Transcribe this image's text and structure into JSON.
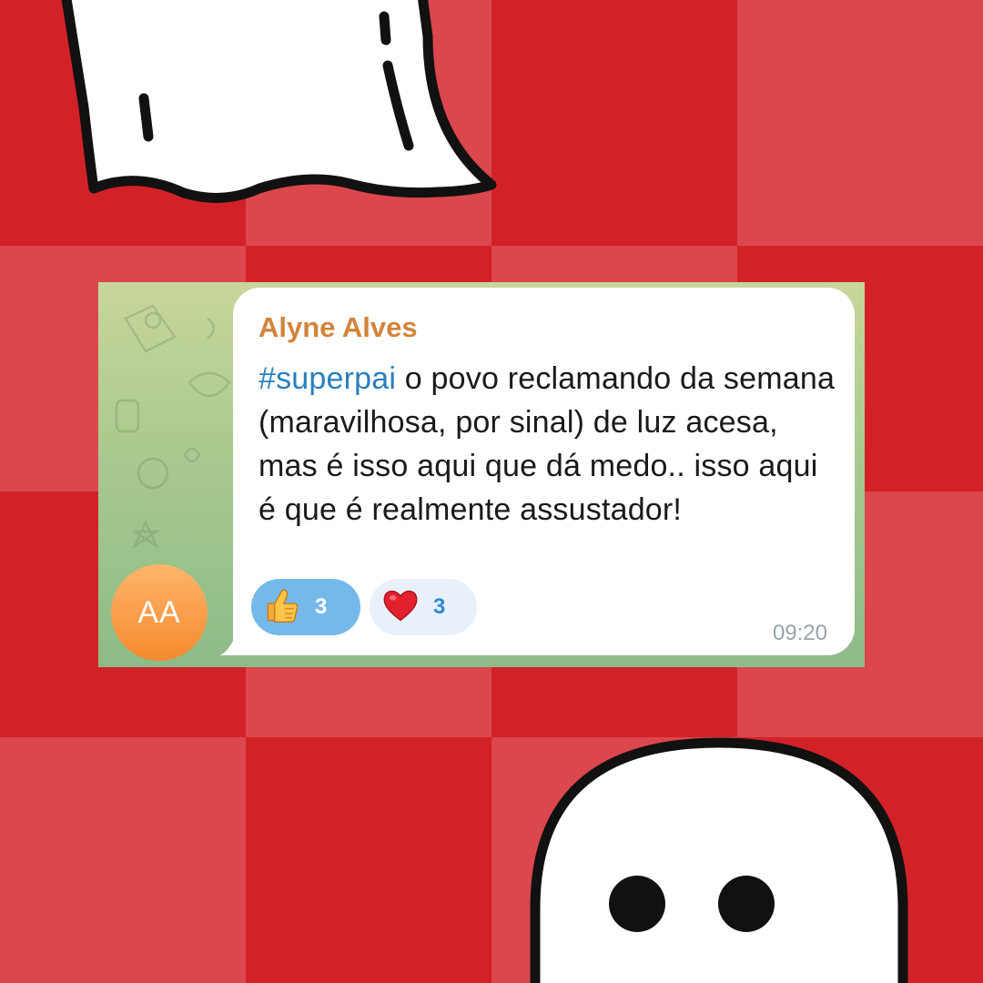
{
  "message": {
    "sender": "Alyne Alves",
    "avatar_initials": "AA",
    "hashtag": "#superpai",
    "text": "o povo reclamando da semana (maravilhosa, por sinal) de luz acesa, mas é isso aqui que dá medo.. isso aqui é que é realmente assustador!",
    "time": "09:20",
    "reactions": [
      {
        "emoji_name": "thumbs-up-icon",
        "count": "3"
      },
      {
        "emoji_name": "heart-icon",
        "count": "3"
      }
    ]
  },
  "colors": {
    "background_dark": "#d32128",
    "background_light": "#db474c",
    "sender": "#d2843b",
    "hashtag": "#2a7fbd",
    "avatar": "#f58a2e",
    "reaction_active": "#74b9ea"
  }
}
